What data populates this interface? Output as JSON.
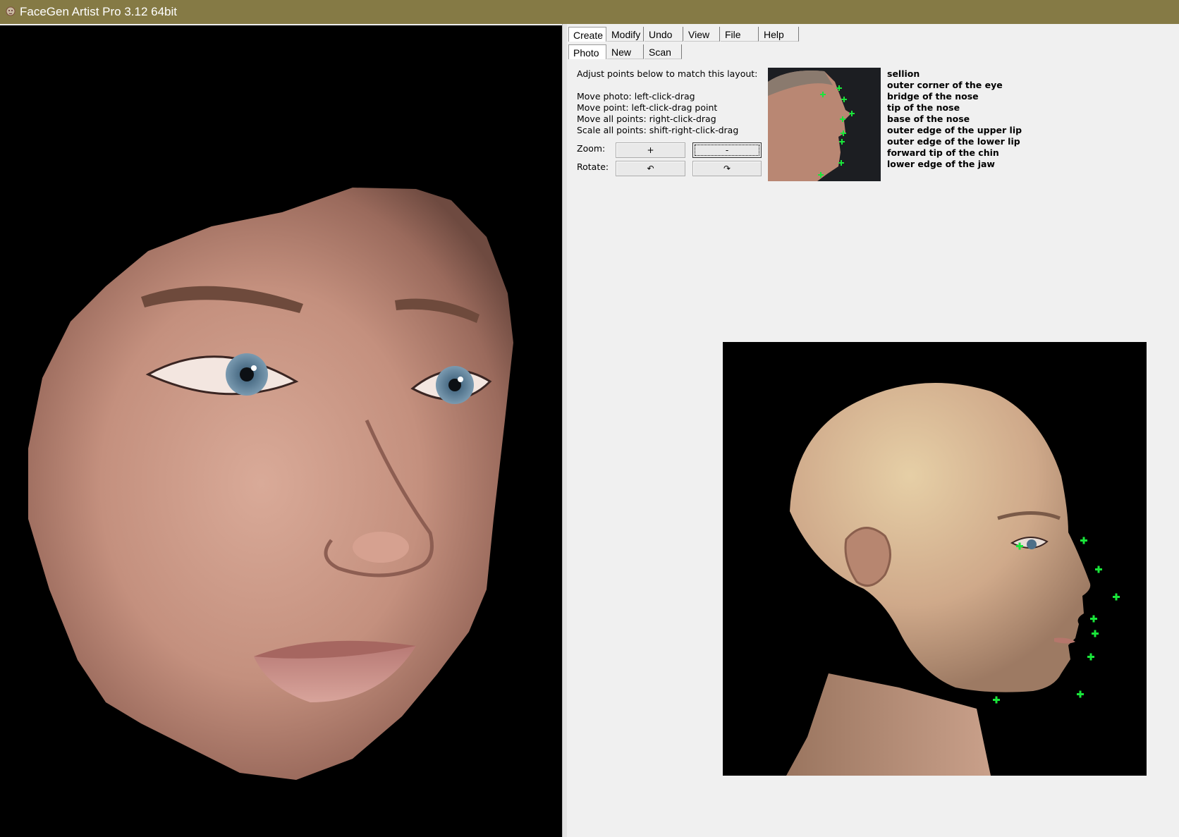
{
  "window": {
    "title": "FaceGen Artist Pro 3.12 64bit"
  },
  "menu_tabs": [
    "Create",
    "Modify",
    "Undo",
    "View",
    "File",
    "Help"
  ],
  "sub_tabs": [
    "Photo",
    "New",
    "Scan"
  ],
  "instructions": {
    "heading": "Adjust points below to match this layout:",
    "lines": [
      "Move photo: left-click-drag",
      "Move point: left-click-drag point",
      "Move all points: right-click-drag",
      "Scale all points: shift-right-click-drag"
    ],
    "zoom_label": "Zoom:",
    "rotate_label": "Rotate:",
    "zoom_in": "+",
    "zoom_out": "-",
    "rotate_left": "↶",
    "rotate_right": "↷"
  },
  "landmarks": [
    "sellion",
    "outer corner of the eye",
    "bridge of the nose",
    "tip of the nose",
    "base of the nose",
    "outer edge of the upper lip",
    "outer edge of the lower lip",
    "forward tip of the chin",
    "lower edge of the jaw"
  ],
  "colors": {
    "titlebar": "#857a45",
    "marker": "#19e63a",
    "viewport_bg": "#000000",
    "panel_bg": "#f0f0f0"
  }
}
